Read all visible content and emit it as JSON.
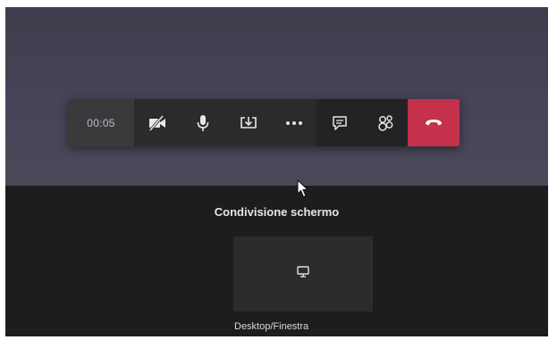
{
  "call_toolbar": {
    "timer": "00:05",
    "buttons": [
      {
        "name": "camera-off",
        "icon": "video-off-icon"
      },
      {
        "name": "microphone",
        "icon": "microphone-icon"
      },
      {
        "name": "share-tray",
        "icon": "share-screen-icon"
      },
      {
        "name": "more-actions",
        "icon": "ellipsis-icon"
      },
      {
        "name": "chat",
        "icon": "chat-icon"
      },
      {
        "name": "participants",
        "icon": "people-icon"
      },
      {
        "name": "hang-up",
        "icon": "phone-hangup-icon"
      }
    ],
    "hangup_color": "#c4314b"
  },
  "share_panel": {
    "title": "Condivisione schermo",
    "options": [
      {
        "label": "Desktop/Finestra",
        "icon": "monitor-icon"
      }
    ]
  }
}
